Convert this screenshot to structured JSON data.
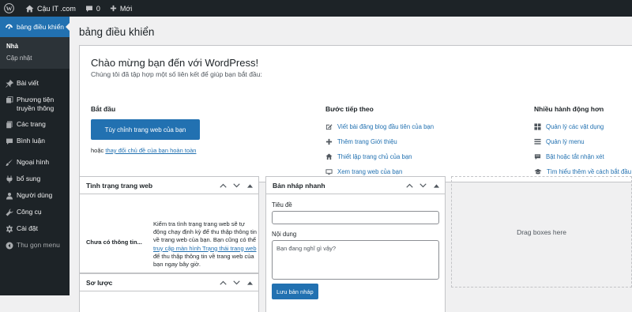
{
  "admin_bar": {
    "site_name": "Cậu IT .com",
    "comments_count": "0",
    "new_label": "Mới"
  },
  "sidebar": {
    "current": "bảng điều khiển",
    "submenu": [
      "Nhà",
      "Cập nhật"
    ],
    "items": [
      {
        "label": "Bài viết",
        "icon": "pin-icon"
      },
      {
        "label": "Phương tiện truyền thông",
        "icon": "media-icon"
      },
      {
        "label": "Các trang",
        "icon": "page-icon"
      },
      {
        "label": "Bình luận",
        "icon": "comment-icon"
      },
      {
        "label": "Ngoại hình",
        "icon": "brush-icon"
      },
      {
        "label": "bổ sung",
        "icon": "plugin-icon"
      },
      {
        "label": "Người dùng",
        "icon": "user-icon"
      },
      {
        "label": "Công cụ",
        "icon": "wrench-icon"
      },
      {
        "label": "Cài đặt",
        "icon": "settings-icon"
      }
    ],
    "collapse_label": "Thu gọn menu"
  },
  "page_title": "bảng điều khiển",
  "welcome": {
    "title": "Chào mừng bạn đến với WordPress!",
    "about": "Chúng tôi đã tập hợp một số liên kết để giúp bạn bắt đầu:",
    "col1": {
      "heading": "Bắt đầu",
      "button": "Tùy chỉnh trang web của bạn",
      "or_text": "hoặc ",
      "or_link": "thay đổi chủ đề của bạn hoàn toàn"
    },
    "col2": {
      "heading": "Bước tiếp theo",
      "links": [
        "Viết bài đăng blog đầu tiên của bạn",
        "Thêm trang Giới thiệu",
        "Thiết lập trang chủ của bạn",
        "Xem trang web của bạn"
      ]
    },
    "col3": {
      "heading": "Nhiều hành động hơn",
      "links": [
        "Quản lý các vật dụng",
        "Quản lý menu",
        "Bật hoặc tắt nhận xét",
        "Tìm hiểu thêm về cách bắt đầu"
      ]
    }
  },
  "site_health": {
    "title": "Tình trạng trang web",
    "status": "Chưa có thông tin...",
    "desc_before": "Kiểm tra tình trạng trang web sẽ tự động chạy định kỳ để thu thập thông tin về trang web của bạn. Bạn cũng có thể ",
    "desc_link": "truy cập màn hình Trạng thái trang web",
    "desc_after": " để thu thập thông tin về trang web của bạn ngay bây giờ."
  },
  "at_a_glance": {
    "title": "Sơ lược"
  },
  "quick_draft": {
    "title": "Bản nháp nhanh",
    "title_label": "Tiêu đề",
    "title_value": "",
    "content_label": "Nội dung",
    "content_placeholder": "Bạn đang nghĩ gì vậy?",
    "save_button": "Lưu bản nháp"
  },
  "drag_area": {
    "text": "Drag boxes here"
  }
}
